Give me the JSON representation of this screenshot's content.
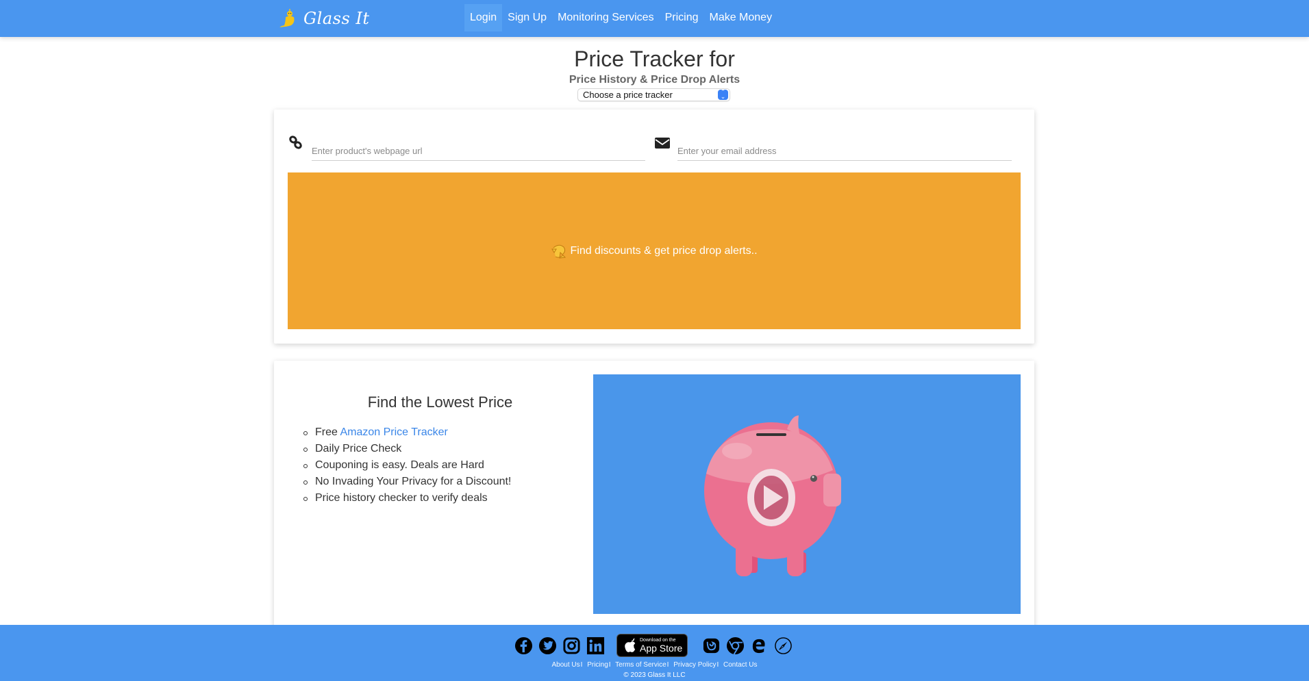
{
  "brand": {
    "name": "Glass It",
    "logo_icon": "genie-lamp-icon"
  },
  "nav": {
    "items": [
      {
        "label": "Login",
        "active": true
      },
      {
        "label": "Sign Up",
        "active": false
      },
      {
        "label": "Monitoring Services",
        "active": false
      },
      {
        "label": "Pricing",
        "active": false
      },
      {
        "label": "Make Money",
        "active": false
      }
    ]
  },
  "hero": {
    "title": "Price Tracker for",
    "subtitle": "Price History & Price Drop Alerts",
    "tracker_select": {
      "selected": "Choose a price tracker"
    }
  },
  "form": {
    "url_input": {
      "placeholder": "Enter product's webpage url",
      "value": "",
      "icon": "link-icon"
    },
    "email_input": {
      "placeholder": "Enter your email address",
      "value": "",
      "icon": "envelope-icon"
    },
    "submit_label": "Find discounts & get price drop alerts..",
    "submit_icon": "refresh-arrow-icon",
    "colors": {
      "cta": "#f1a530"
    }
  },
  "features": {
    "title": "Find the Lowest Price",
    "items": [
      {
        "prefix": "Free ",
        "link": "Amazon Price Tracker"
      },
      {
        "prefix": "Daily Price Check",
        "link": ""
      },
      {
        "prefix": "Couponing is easy. Deals are Hard",
        "link": ""
      },
      {
        "prefix": "No Invading Your Privacy for a Discount!",
        "link": ""
      },
      {
        "prefix": "Price history checker to verify deals",
        "link": ""
      }
    ],
    "video": {
      "thumbnail": "piggy-bank-icon",
      "control": "play-icon"
    }
  },
  "footer": {
    "social": [
      "facebook-icon",
      "twitter-icon",
      "instagram-icon",
      "linkedin-icon"
    ],
    "app_store": {
      "line1": "Download on the",
      "line2": "App Store"
    },
    "browsers": [
      "firefox-icon",
      "chrome-icon",
      "edge-icon",
      "safari-icon"
    ],
    "links": [
      "About Us",
      "Pricing",
      "Terms of Service",
      "Privacy Policy",
      "Contact Us"
    ],
    "separator": "I",
    "copyright": "© 2023 Glass It LLC"
  },
  "colors": {
    "primary": "#4a96ef",
    "accent": "#f1a530",
    "link": "#3a86e8"
  }
}
